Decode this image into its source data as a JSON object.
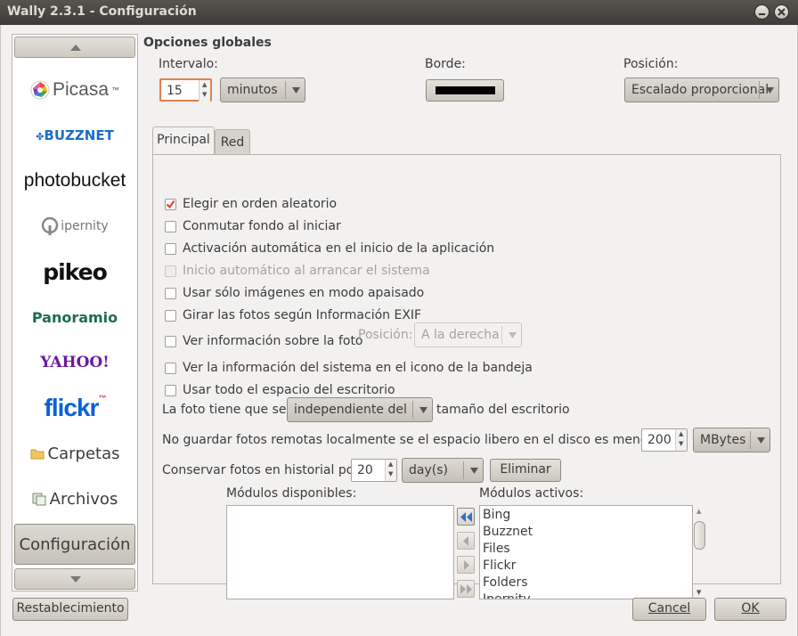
{
  "window": {
    "title": "Wally 2.3.1 - Configuración"
  },
  "sidebar": {
    "items": [
      {
        "label": "Picasa",
        "tm": "™"
      },
      {
        "label": "BUZZNET"
      },
      {
        "label": "photobucket"
      },
      {
        "label": "ipernity"
      },
      {
        "label": "pikeo"
      },
      {
        "label": "Panoramio"
      },
      {
        "label": "YAHOO!"
      },
      {
        "label": "flickr",
        "tm": "™"
      },
      {
        "label": "Carpetas"
      },
      {
        "label": "Archivos"
      },
      {
        "label": "Configuración"
      }
    ]
  },
  "global": {
    "heading": "Opciones globales",
    "interval_label": "Intervalo:",
    "interval_value": "15",
    "interval_unit": "minutos",
    "border_label": "Borde:",
    "border_color": "#000000",
    "position_label": "Posición:",
    "position_value": "Escalado proporcional"
  },
  "tabs": [
    "Principal",
    "Red"
  ],
  "options": [
    {
      "label": "Elegir en orden aleatorio",
      "checked": true,
      "disabled": false
    },
    {
      "label": "Conmutar fondo al iniciar",
      "checked": false,
      "disabled": false
    },
    {
      "label": "Activación automática en el inicio de la aplicación",
      "checked": false,
      "disabled": false
    },
    {
      "label": "Inicio automático al arrancar el sistema",
      "checked": false,
      "disabled": true
    },
    {
      "label": "Usar sólo imágenes en modo apaisado",
      "checked": false,
      "disabled": false
    },
    {
      "label": "Girar las fotos según Información EXIF",
      "checked": false,
      "disabled": false
    },
    {
      "label": "Ver información sobre la foto",
      "checked": false,
      "disabled": false
    },
    {
      "label": "Ver la información del sistema en el icono de la bandeja",
      "checked": false,
      "disabled": false
    },
    {
      "label": "Usar todo el espacio del escritorio",
      "checked": false,
      "disabled": false
    }
  ],
  "photo_info": {
    "position_label": "Posición:",
    "position_value": "A la derecha"
  },
  "size_row": {
    "prefix": "La foto tiene que ser",
    "value": "independiente del",
    "suffix": "tamaño del escritorio"
  },
  "disk_row": {
    "label": "No guardar fotos remotas localmente se el espacio libero en el disco es menor de",
    "value": "200",
    "unit": "MBytes"
  },
  "history_row": {
    "label": "Conservar fotos en historial por",
    "value": "20",
    "unit": "day(s)",
    "delete_label": "Eliminar"
  },
  "modules": {
    "available_label": "Módulos disponibles:",
    "active_label": "Módulos activos:",
    "available": [],
    "active": [
      "Bing",
      "Buzznet",
      "Files",
      "Flickr",
      "Folders",
      "Ipernity"
    ]
  },
  "footer": {
    "reset_label": "Restablecimiento",
    "cancel_label": "Cancel",
    "ok_label": "OK"
  }
}
